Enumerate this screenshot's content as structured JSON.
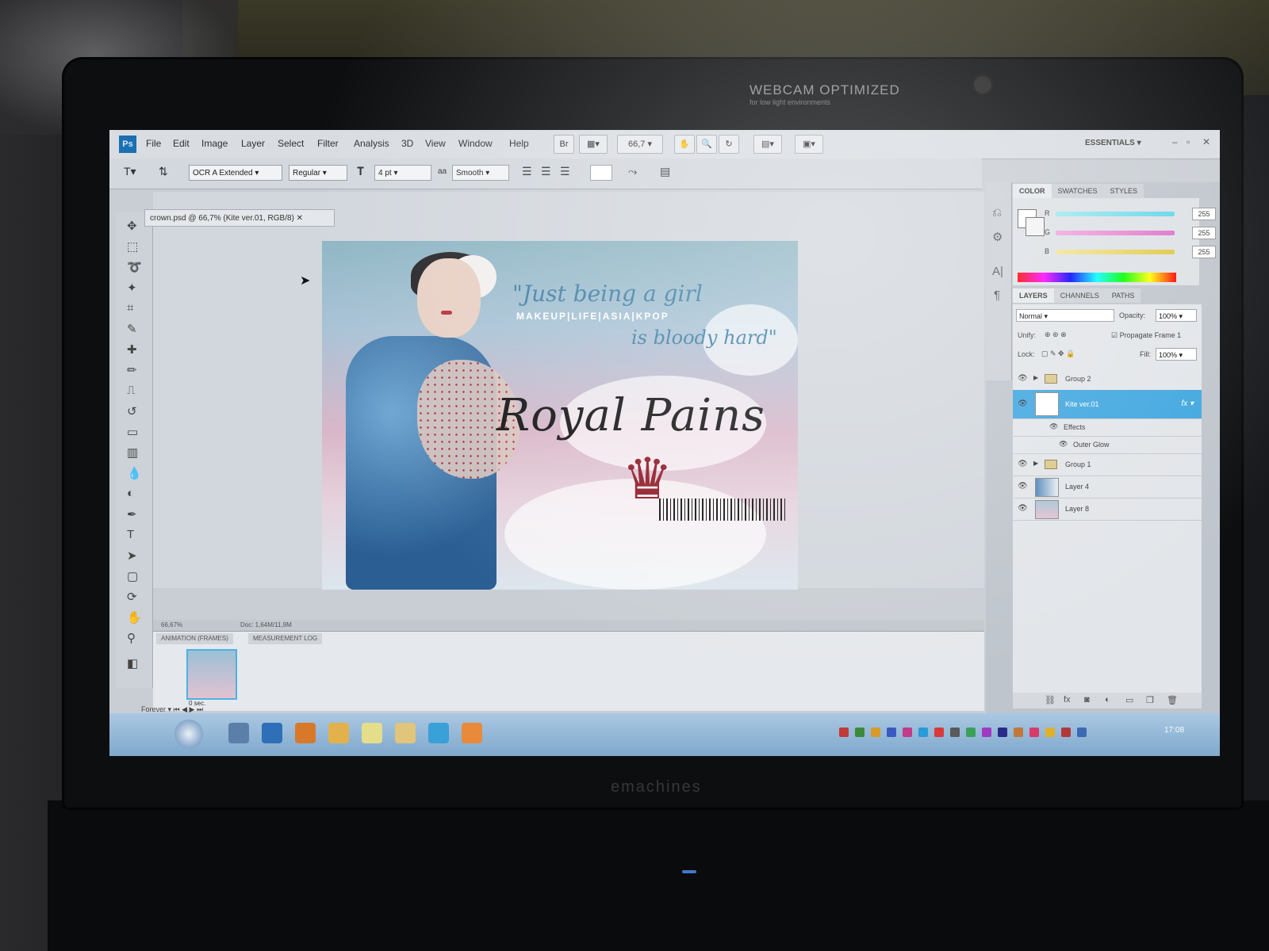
{
  "hardware": {
    "webcam_label": "WEBCAM OPTIMIZED",
    "webcam_sub": "for low light environments",
    "brand": "emachines"
  },
  "app": {
    "logo": "Ps",
    "menus": [
      "File",
      "Edit",
      "Image",
      "Layer",
      "Select",
      "Filter",
      "Analysis",
      "3D",
      "View",
      "Window",
      "Help"
    ],
    "zoom": "66,7",
    "workspace": "ESSENTIALS"
  },
  "options": {
    "font_family": "OCR A Extended",
    "font_style": "Regular",
    "font_size": "4 pt",
    "antialias": "Smooth"
  },
  "document": {
    "tab_title": "crown.psd @ 66,7% (Kite ver.01, RGB/8)",
    "status_zoom": "66,67%",
    "status_doc": "Doc: 1,64M/11,9M"
  },
  "artwork": {
    "quote_line1": "\"Just being a girl",
    "quote_line2": "is bloody hard\"",
    "tagline": "MAKEUP|LIFE|ASIA|KPOP",
    "title": "Royal Pains"
  },
  "animation": {
    "tab_animation": "ANIMATION (FRAMES)",
    "tab_measurement": "MEASUREMENT LOG",
    "frame_delay": "0 sec.",
    "loop": "Forever"
  },
  "color_panel": {
    "tabs": [
      "COLOR",
      "SWATCHES",
      "STYLES"
    ],
    "channels": [
      {
        "label": "R",
        "value": "255",
        "color": "#5fd6e8"
      },
      {
        "label": "G",
        "value": "255",
        "color": "#e070c8"
      },
      {
        "label": "B",
        "value": "255",
        "color": "#e0c840"
      }
    ]
  },
  "layers_panel": {
    "tabs": [
      "LAYERS",
      "CHANNELS",
      "PATHS"
    ],
    "blend_mode": "Normal",
    "opacity_label": "Opacity:",
    "opacity": "100%",
    "unify_label": "Unify:",
    "propagate": "Propagate Frame 1",
    "lock_label": "Lock:",
    "fill_label": "Fill:",
    "fill": "100%",
    "layers": [
      {
        "name": "Group 2",
        "kind": "group"
      },
      {
        "name": "Kite ver.01",
        "kind": "text",
        "selected": true
      },
      {
        "name": "Effects",
        "kind": "effect"
      },
      {
        "name": "Outer Glow",
        "kind": "effect"
      },
      {
        "name": "Group 1",
        "kind": "group"
      },
      {
        "name": "Layer 4",
        "kind": "image"
      },
      {
        "name": "Layer 8",
        "kind": "image"
      }
    ]
  },
  "taskbar": {
    "clock": "17:08"
  },
  "colors": {
    "selection": "#3fa6df",
    "taskbar": "#8fb4d6",
    "crown": "#8f1a27"
  }
}
